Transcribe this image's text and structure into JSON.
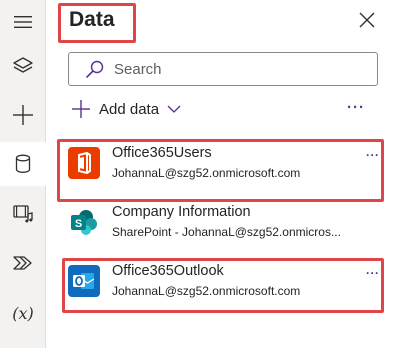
{
  "panel": {
    "title": "Data"
  },
  "search": {
    "placeholder": "Search"
  },
  "toolbar": {
    "add_label": "Add data",
    "more": "···"
  },
  "connections": [
    {
      "name": "Office365Users",
      "subtitle": "JohannaL@szg52.onmicrosoft.com",
      "icon": "office-icon",
      "color": "#eb3c00",
      "more": "···"
    },
    {
      "name": "Company Information",
      "subtitle": "SharePoint - JohannaL@szg52.onmicros...",
      "icon": "sharepoint-icon",
      "color": "#038387",
      "more": "···"
    },
    {
      "name": "Office365Outlook",
      "subtitle": "JohannaL@szg52.onmicrosoft.com",
      "icon": "outlook-icon",
      "color": "#0f6cbd",
      "more": "···"
    }
  ],
  "rail": {
    "variables_label": "(x)"
  },
  "colors": {
    "highlight": "#e04648",
    "accent": "#5b2d91"
  }
}
